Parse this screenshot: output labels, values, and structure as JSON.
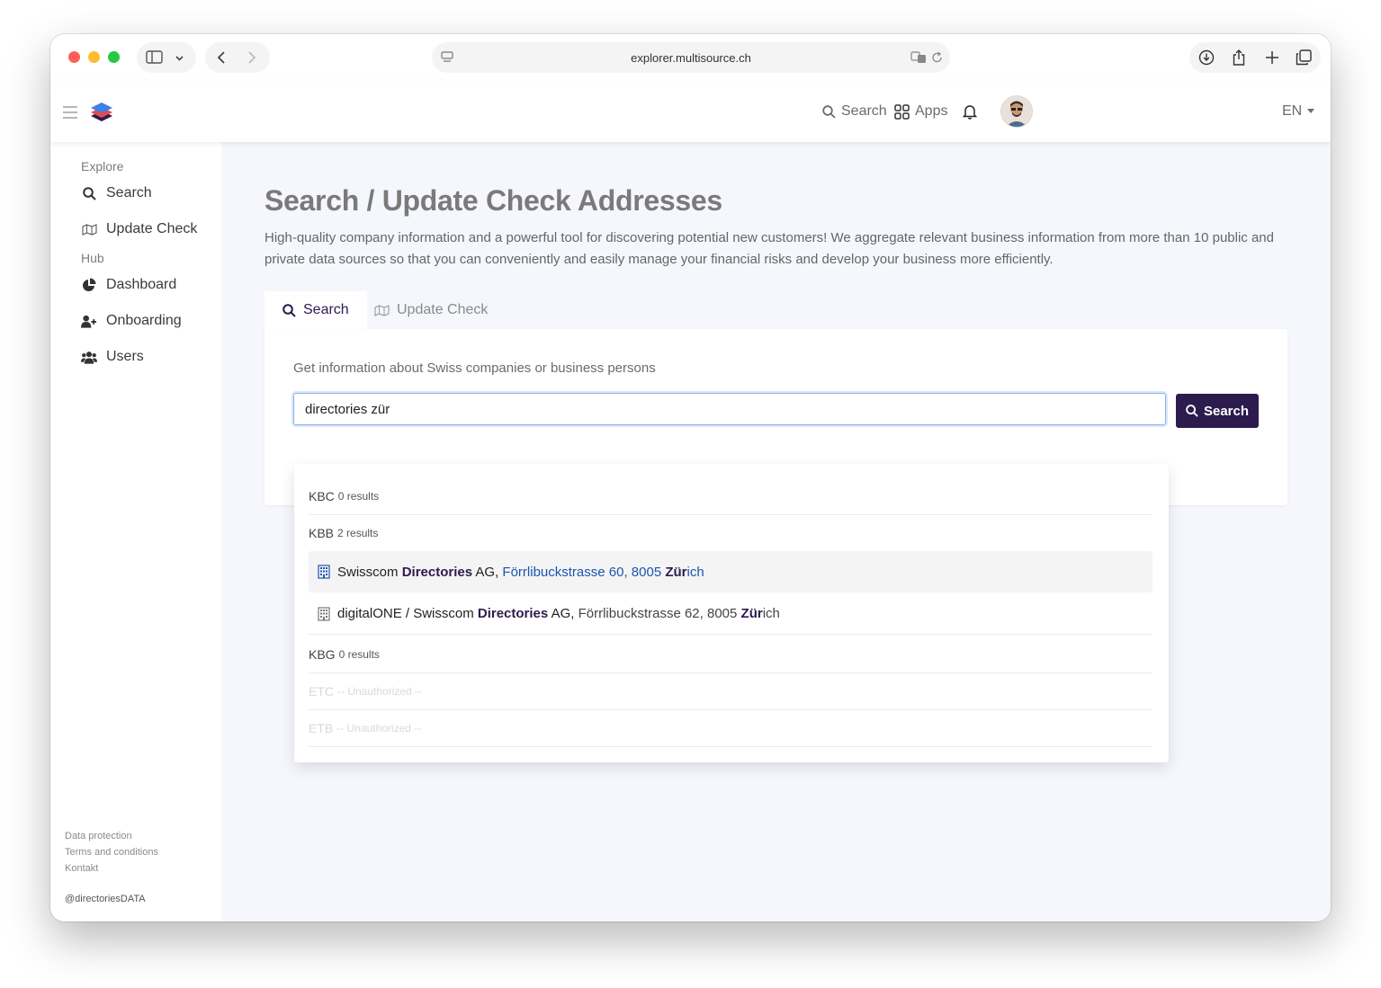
{
  "browser": {
    "url": "explorer.multisource.ch"
  },
  "header": {
    "search_label": "Search",
    "apps_label": "Apps",
    "language": "EN"
  },
  "sidebar": {
    "sections": [
      {
        "title": "Explore",
        "items": [
          {
            "label": "Search"
          },
          {
            "label": "Update Check"
          }
        ]
      },
      {
        "title": "Hub",
        "items": [
          {
            "label": "Dashboard"
          },
          {
            "label": "Onboarding"
          },
          {
            "label": "Users"
          }
        ]
      }
    ],
    "footer_links": [
      "Data protection",
      "Terms and conditions",
      "Kontakt"
    ],
    "handle": "@directoriesDATA"
  },
  "main": {
    "title": "Search / Update Check Addresses",
    "description": "High-quality company information and a powerful tool for discovering potential new customers! We aggregate relevant business information from more than 10 public and private data sources so that you can conveniently and easily manage your financial risks and develop your business more efficiently.",
    "tabs": [
      {
        "label": "Search",
        "active": true
      },
      {
        "label": "Update Check",
        "active": false
      }
    ],
    "card": {
      "label": "Get information about Swiss companies or business persons",
      "search_value": "directories zür",
      "search_button": "Search"
    }
  },
  "dropdown": {
    "groups": [
      {
        "code": "KBC",
        "count": "0 results"
      },
      {
        "code": "KBB",
        "count": "2 results"
      },
      {
        "code": "KBG",
        "count": "0 results"
      },
      {
        "code": "ETC",
        "count": "-- Unauthorized --"
      },
      {
        "code": "ETB",
        "count": "-- Unauthorized --"
      }
    ],
    "results": [
      {
        "pre": "Swisscom ",
        "match": "Directories",
        "post": " AG, ",
        "addr": "Förrlibuckstrasse 60, 8005 ",
        "city_match": "Zür",
        "city_rest": "ich"
      },
      {
        "pre": "digitalONE / Swisscom ",
        "match": "Directories",
        "post": " AG, ",
        "addr": "Förrlibuckstrasse 62, 8005 ",
        "city_match": "Zür",
        "city_rest": "ich"
      }
    ]
  },
  "colors": {
    "brand": "#2d1b4e",
    "link": "#1a56b0",
    "background": "#f5f7fd"
  }
}
